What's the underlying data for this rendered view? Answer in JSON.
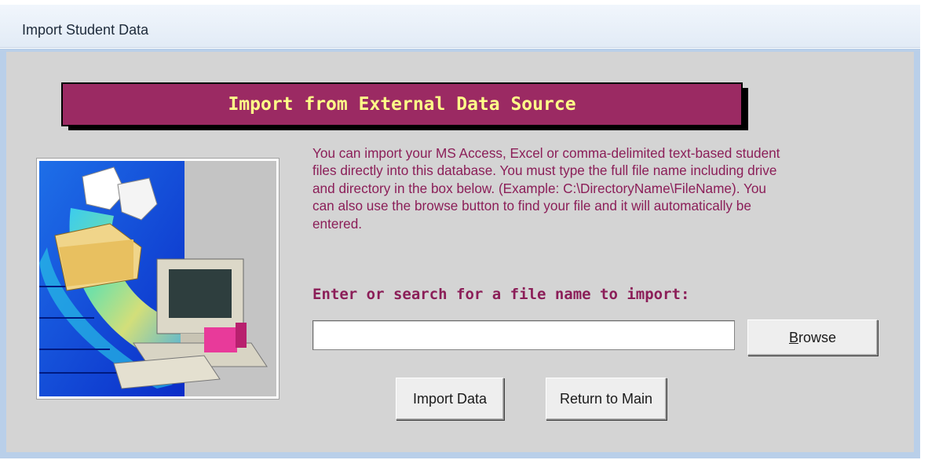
{
  "window": {
    "title": "Import Student Data"
  },
  "banner": {
    "title": "Import from External Data Source"
  },
  "clipart": {
    "icon": "computer-with-documents-illustration"
  },
  "description": {
    "text": "You can import your MS Access, Excel or comma-delimited text-based student files directly into this database.   You must type the full file name including drive and directory  in the box below.   (Example:  C:\\DirectoryName\\FileName). You can also use the browse button to find your file and it will automatically be entered."
  },
  "file_input": {
    "label": "Enter or search for a file name to import:",
    "value": ""
  },
  "buttons": {
    "browse_accel": "B",
    "browse_rest": "rowse",
    "import": "Import Data",
    "return": "Return to Main"
  },
  "colors": {
    "banner_bg": "#9b2a63",
    "banner_text": "#ffff88",
    "label_text": "#8b1e58",
    "form_bg": "#d4d4d4",
    "frame_border": "#b9cfe9"
  }
}
